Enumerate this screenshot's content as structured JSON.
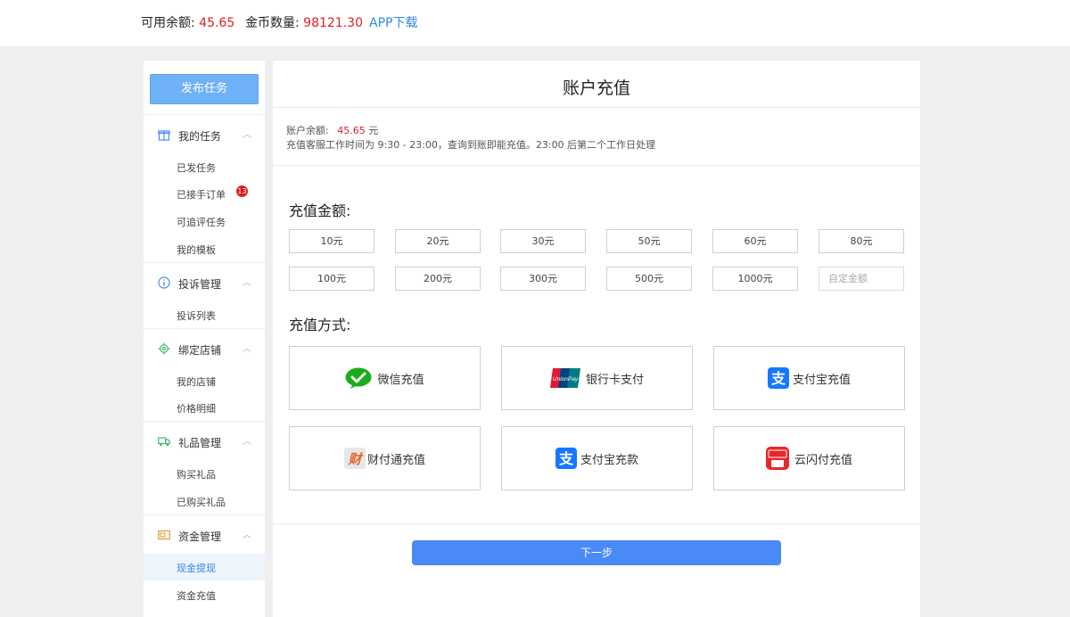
{
  "topbar": {
    "balance_label": "可用余额:",
    "balance_value": "45.65",
    "coins_label": "金币数量:",
    "coins_value": "98121.30",
    "app_download": "APP下载"
  },
  "sidebar": {
    "publish_button": "发布任务",
    "groups": [
      {
        "label": "我的任务",
        "icon": "gift-icon",
        "items": [
          {
            "label": "已发任务"
          },
          {
            "label": "已接手订单",
            "badge": "13"
          },
          {
            "label": "可追评任务"
          },
          {
            "label": "我的模板"
          }
        ]
      },
      {
        "label": "投诉管理",
        "icon": "info-circle-icon",
        "items": [
          {
            "label": "投诉列表"
          }
        ]
      },
      {
        "label": "绑定店铺",
        "icon": "gear-icon",
        "items": [
          {
            "label": "我的店铺"
          },
          {
            "label": "价格明细"
          }
        ]
      },
      {
        "label": "礼品管理",
        "icon": "truck-icon",
        "items": [
          {
            "label": "购买礼品"
          },
          {
            "label": "已购买礼品"
          }
        ]
      },
      {
        "label": "资金管理",
        "icon": "wallet-icon",
        "items": [
          {
            "label": "现金提现",
            "active": true
          },
          {
            "label": "资金充值"
          }
        ]
      }
    ]
  },
  "main": {
    "title": "账户充值",
    "balance_label": "账户余额:",
    "balance_value": "45.65",
    "balance_unit": "元",
    "notice": "充值客服工作时间为 9:30 - 23:00，查询到账即能充值。23:00 后第二个工作日处理",
    "amount_title": "充值金额:",
    "amounts": [
      "10元",
      "20元",
      "30元",
      "50元",
      "60元",
      "80元",
      "100元",
      "200元",
      "300元",
      "500元",
      "1000元"
    ],
    "custom_amount_placeholder": "自定金额",
    "method_title": "充值方式:",
    "methods": [
      {
        "label": "微信充值",
        "icon": "wechat-icon"
      },
      {
        "label": "银行卡支付",
        "icon": "unionpay-icon"
      },
      {
        "label": "支付宝充值",
        "icon": "alipay-icon"
      },
      {
        "label": "财付通充值",
        "icon": "tenpay-icon"
      },
      {
        "label": "支付宝充款",
        "icon": "alipay-icon"
      },
      {
        "label": "云闪付充值",
        "icon": "quickpass-icon"
      }
    ],
    "next_button": "下一步"
  },
  "colors": {
    "accent_blue": "#4a8af7",
    "highlight_red": "#e02020",
    "link_blue": "#2e8ae6"
  }
}
